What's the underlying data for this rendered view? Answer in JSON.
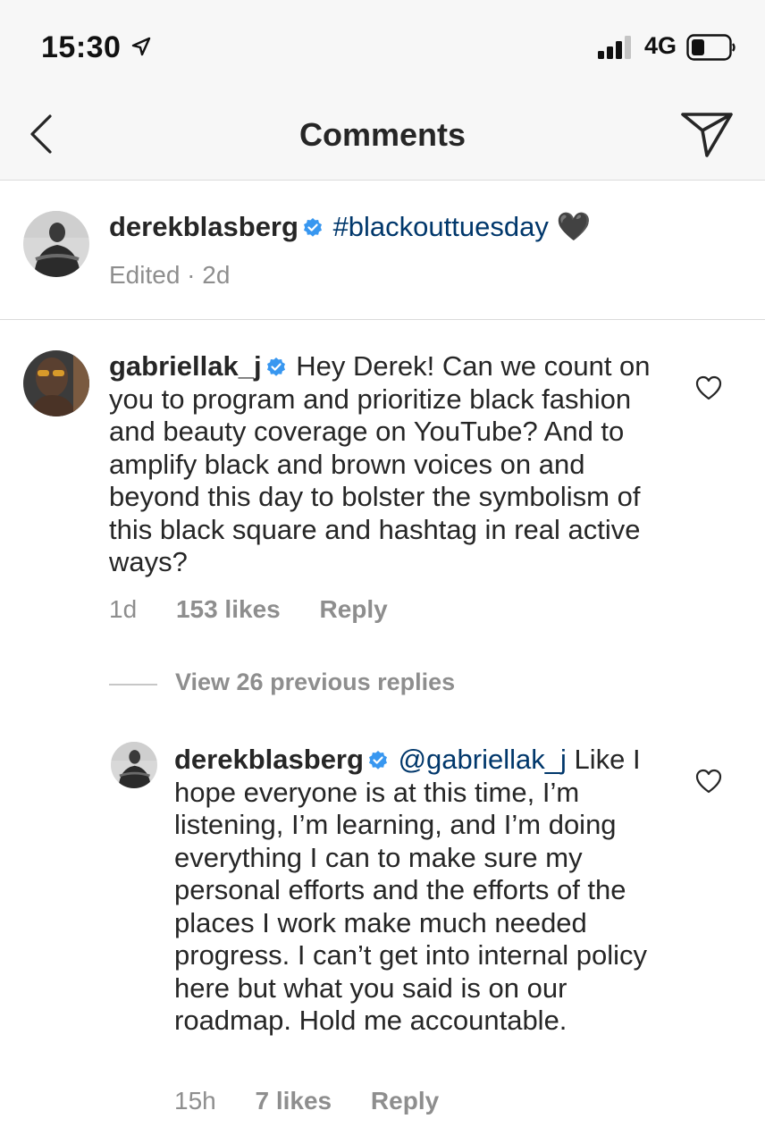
{
  "status_bar": {
    "time": "15:30",
    "network": "4G"
  },
  "nav": {
    "title": "Comments"
  },
  "caption": {
    "username": "derekblasberg",
    "text": "#blackouttuesday",
    "emoji": "🖤",
    "meta": "Edited · 2d"
  },
  "comment": {
    "username": "gabriellak_j",
    "text": "Hey Derek! Can we count on you to program and prioritize black fashion and beauty coverage on YouTube? And to amplify black and brown voices on and beyond this day to bolster the symbolism of this black square and hashtag in real active ways?",
    "time": "1d",
    "likes": "153 likes",
    "reply_label": "Reply"
  },
  "view_replies": {
    "label": "View 26 previous replies"
  },
  "reply": {
    "username": "derekblasberg",
    "mention": "@gabriellak_j",
    "text": "Like I hope everyone is at this time, I’m listening, I’m learning, and I’m doing everything I can to make sure my personal efforts and the efforts of the places I work make much needed progress. I can’t get into internal policy here but what you said is on our roadmap. Hold me accountable.",
    "time": "15h",
    "likes": "7 likes",
    "reply_label": "Reply"
  },
  "colors": {
    "link": "#00376b",
    "verified": "#3897f0",
    "meta": "#8e8e8e",
    "divider": "#dbdbdb"
  },
  "icons": [
    "location-arrow-icon",
    "signal-icon",
    "battery-icon",
    "back-chevron-icon",
    "send-paper-plane-icon",
    "verified-badge-icon",
    "heart-icon"
  ]
}
